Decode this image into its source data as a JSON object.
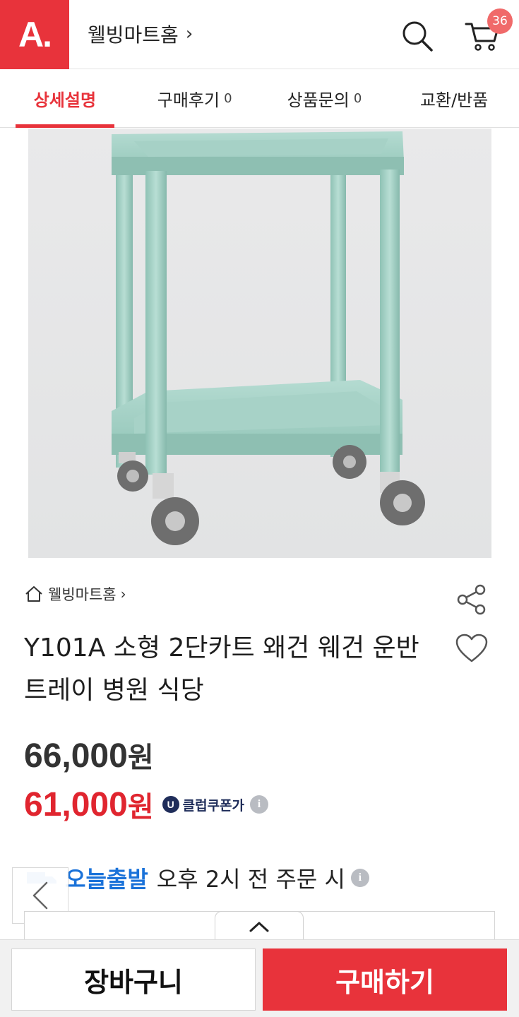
{
  "header": {
    "logo_text": "A.",
    "store_name": "웰빙마트홈",
    "cart_count": "36"
  },
  "tabs": [
    {
      "label": "상세설명",
      "count": ""
    },
    {
      "label": "구매후기",
      "count": "0"
    },
    {
      "label": "상품문의",
      "count": "0"
    },
    {
      "label": "교환/반품",
      "count": ""
    }
  ],
  "product": {
    "store_crumb": "웰빙마트홈",
    "title": "Y101A 소형 2단카트 왜건 웨건 운반트레이 병원 식당",
    "original_price": "66,000",
    "sale_price": "61,000",
    "currency_unit": "원",
    "coupon_badge": "U",
    "coupon_text": "클럽쿠폰가",
    "shipping_label": "오늘출발",
    "shipping_condition": "오후 2시 전 주문 시",
    "image_color": "#9fcfc3"
  },
  "actions": {
    "cart_label": "장바구니",
    "buy_label": "구매하기"
  },
  "colors": {
    "brand_red": "#e8333b",
    "sale_red": "#e0252f",
    "shipping_blue": "#1a72d9",
    "coupon_navy": "#1f2d5a"
  }
}
